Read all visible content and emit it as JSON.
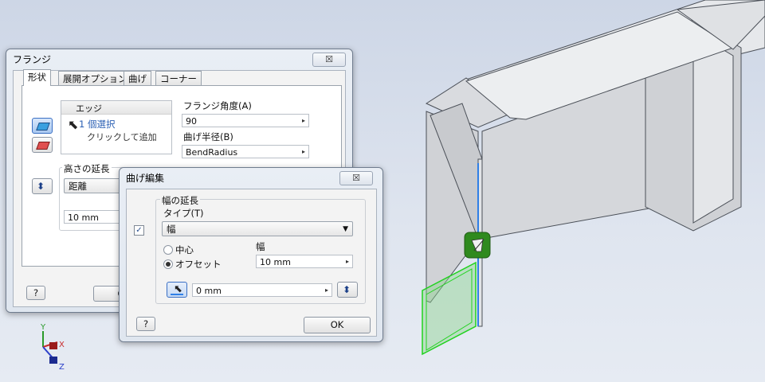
{
  "flange_dialog": {
    "title": "フランジ",
    "close_glyph": "☒",
    "tabs": [
      "形状",
      "展開オプション",
      "曲げ",
      "コーナー"
    ],
    "edges_header": "エッジ",
    "edges_selected": "1 個選択",
    "edges_hint": "クリックして追加",
    "flange_angle_label": "フランジ角度(A)",
    "flange_angle_value": "90",
    "bend_radius_label": "曲げ半径(B)",
    "bend_radius_value": "BendRadius",
    "height_extent_label": "高さの延長",
    "height_extent_type": "距離",
    "height_value": "10 mm",
    "help_glyph": "?",
    "ok_partial": "O"
  },
  "bend_edit_dialog": {
    "title": "曲げ編集",
    "close_glyph": "☒",
    "width_extent_label": "幅の延長",
    "type_label": "タイプ(T)",
    "type_value": "幅",
    "radio_center": "中心",
    "radio_offset": "オフセット",
    "width_label": "幅",
    "width_value": "10 mm",
    "offset_value": "0 mm",
    "ok_label": "OK",
    "help_glyph": "?",
    "checkbox_glyph": "✓",
    "radio_selected": "offset"
  },
  "triad": {
    "x": "X",
    "y": "Y",
    "z": "Z"
  },
  "colors": {
    "model_face": "#d7d9dd",
    "model_edge": "#4a4f57",
    "selected_edge": "#2f7fe6",
    "preview_face": "#8bd38d",
    "preview_edge": "#21d21f",
    "marker": "#2f8a1e"
  }
}
